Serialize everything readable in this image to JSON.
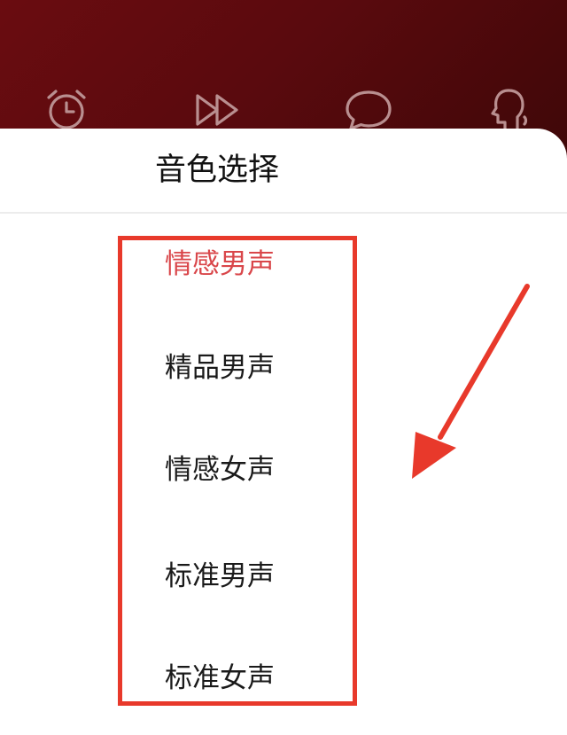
{
  "toolbar": {
    "icons": [
      "alarm-clock-icon",
      "fast-forward-icon",
      "comment-bubble-icon",
      "voice-head-icon"
    ]
  },
  "sheet": {
    "title": "音色选择",
    "options": [
      {
        "label": "情感男声",
        "selected": true
      },
      {
        "label": "精品男声",
        "selected": false
      },
      {
        "label": "情感女声",
        "selected": false
      },
      {
        "label": "标准男声",
        "selected": false
      },
      {
        "label": "标准女声",
        "selected": false
      }
    ]
  },
  "colors": {
    "header_bg": "#5a0a0e",
    "selected_text": "#d9464a",
    "annotation_red": "#e8392b"
  }
}
